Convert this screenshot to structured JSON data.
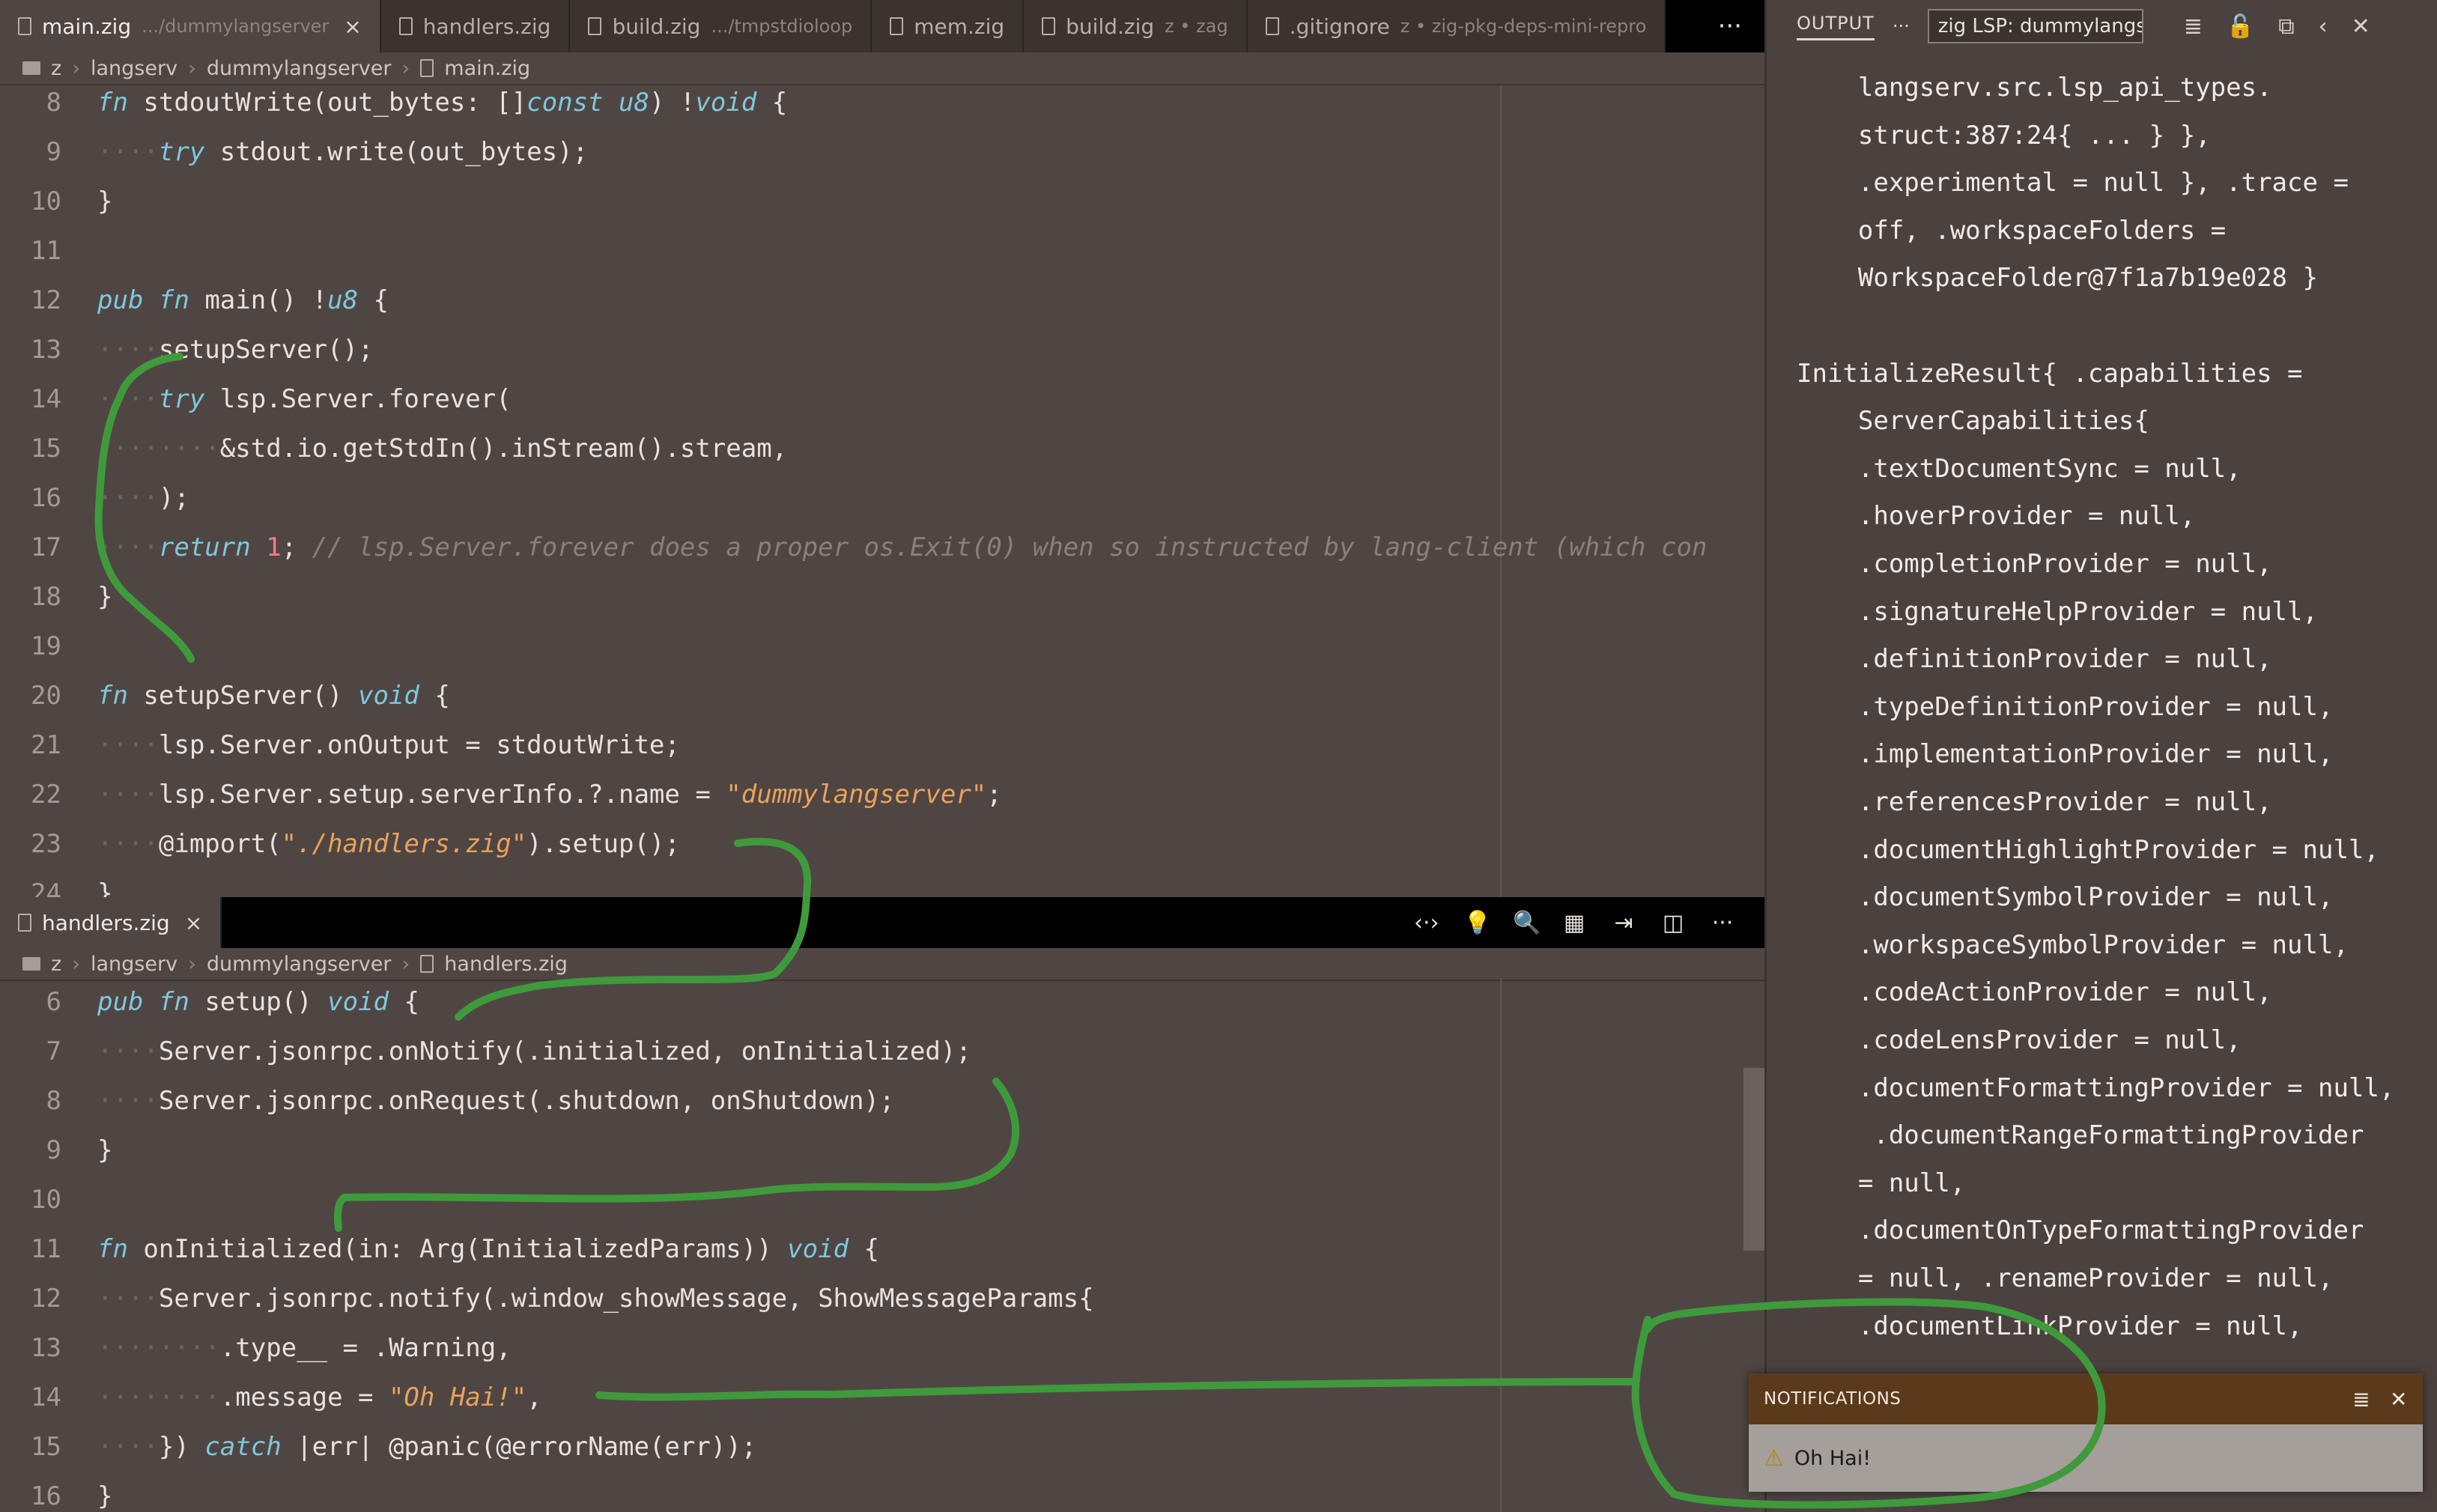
{
  "editor_top": {
    "tabs": [
      {
        "label": "main.zig",
        "sub": ".../dummylangserver",
        "active": true,
        "close": "×"
      },
      {
        "label": "handlers.zig",
        "sub": ""
      },
      {
        "label": "build.zig",
        "sub": ".../tmpstdioloop"
      },
      {
        "label": "mem.zig",
        "sub": ""
      },
      {
        "label": "build.zig",
        "sub": "z • zag"
      },
      {
        "label": ".gitignore",
        "sub": "z • zig-pkg-deps-mini-repro"
      }
    ],
    "more_label": "···",
    "breadcrumb": [
      "z",
      "langserv",
      "dummylangserver",
      "main.zig"
    ],
    "lines": [
      {
        "n": "8",
        "text": "fn stdoutWrite(out_bytes: []const u8) !void {"
      },
      {
        "n": "9",
        "text": "    try stdout.write(out_bytes);"
      },
      {
        "n": "10",
        "text": "}"
      },
      {
        "n": "11",
        "text": ""
      },
      {
        "n": "12",
        "text": "pub fn main() !u8 {"
      },
      {
        "n": "13",
        "text": "    setupServer();"
      },
      {
        "n": "14",
        "text": "    try lsp.Server.forever("
      },
      {
        "n": "15",
        "text": "        &std.io.getStdIn().inStream().stream,"
      },
      {
        "n": "16",
        "text": "    );"
      },
      {
        "n": "17",
        "text": "    return 1; // lsp.Server.forever does a proper os.Exit(0) when so instructed by lang-client (which con"
      },
      {
        "n": "18",
        "text": "}"
      },
      {
        "n": "19",
        "text": ""
      },
      {
        "n": "20",
        "text": "fn setupServer() void {"
      },
      {
        "n": "21",
        "text": "    lsp.Server.onOutput = stdoutWrite;"
      },
      {
        "n": "22",
        "text": "    lsp.Server.setup.serverInfo.?.name = \"dummylangserver\";"
      },
      {
        "n": "23",
        "text": "    @import(\"./handlers.zig\").setup();"
      },
      {
        "n": "24",
        "text": "}"
      }
    ]
  },
  "editor_bottom": {
    "tab": {
      "label": "handlers.zig",
      "close": "×"
    },
    "actions": [
      "‹·›",
      "💡",
      "🔍",
      "▦",
      "⇥",
      "◫",
      "···"
    ],
    "breadcrumb": [
      "z",
      "langserv",
      "dummylangserver",
      "handlers.zig"
    ],
    "lines": [
      {
        "n": "6",
        "text": "pub fn setup() void {"
      },
      {
        "n": "7",
        "text": "    Server.jsonrpc.onNotify(.initialized, onInitialized);"
      },
      {
        "n": "8",
        "text": "    Server.jsonrpc.onRequest(.shutdown, onShutdown);"
      },
      {
        "n": "9",
        "text": "}"
      },
      {
        "n": "10",
        "text": ""
      },
      {
        "n": "11",
        "text": "fn onInitialized(in: Arg(InitializedParams)) void {"
      },
      {
        "n": "12",
        "text": "    Server.jsonrpc.notify(.window_showMessage, ShowMessageParams{"
      },
      {
        "n": "13",
        "text": "        .type__ = .Warning,"
      },
      {
        "n": "14",
        "text": "        .message = \"Oh Hai!\","
      },
      {
        "n": "15",
        "text": "    }) catch |err| @panic(@errorName(err));"
      },
      {
        "n": "16",
        "text": "}"
      }
    ]
  },
  "output": {
    "title": "OUTPUT",
    "more": "···",
    "channel": "zig LSP: dummylangserver",
    "icons": [
      "list-icon",
      "lock-icon",
      "copy-icon",
      "back-icon",
      "close-icon"
    ],
    "lines": [
      "    langserv.src.lsp_api_types.",
      "    struct:387:24{ ... } },",
      "    .experimental = null }, .trace =",
      "    off, .workspaceFolders =",
      "    WorkspaceFolder@7f1a7b19e028 }",
      "",
      "InitializeResult{ .capabilities =",
      "    ServerCapabilities{",
      "    .textDocumentSync = null,",
      "    .hoverProvider = null,",
      "    .completionProvider = null,",
      "    .signatureHelpProvider = null,",
      "    .definitionProvider = null,",
      "    .typeDefinitionProvider = null,",
      "    .implementationProvider = null,",
      "    .referencesProvider = null,",
      "    .documentHighlightProvider = null,",
      "    .documentSymbolProvider = null,",
      "    .workspaceSymbolProvider = null,",
      "    .codeActionProvider = null,",
      "    .codeLensProvider = null,",
      "    .documentFormattingProvider = null,",
      "     .documentRangeFormattingProvider",
      "    = null,",
      "    .documentOnTypeFormattingProvider",
      "    = null, .renameProvider = null,",
      "    .documentLinkProvider = null,"
    ]
  },
  "notification": {
    "header": "NOTIFICATIONS",
    "message": "Oh Hai!"
  },
  "colors": {
    "editor_bg": "#4f4643",
    "annotation_ink": "#3f9a3c",
    "notification_header": "#5b3a1b"
  }
}
